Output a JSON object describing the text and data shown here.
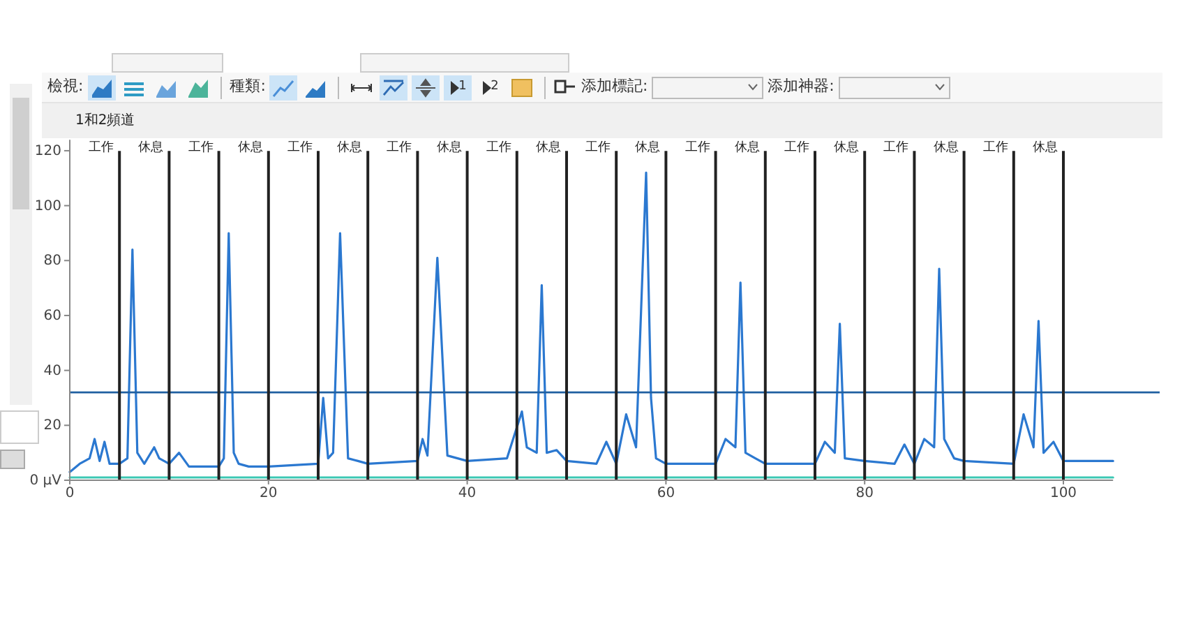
{
  "toolbar": {
    "view_label": "檢視:",
    "view_buttons": [
      {
        "selected": true
      },
      {
        "selected": false
      },
      {
        "selected": false
      },
      {
        "selected": false
      }
    ],
    "type_label": "種類:",
    "type_buttons": [
      {
        "selected": true
      },
      {
        "selected": false
      }
    ],
    "tool_buttons": [
      {
        "kind": "fit",
        "selected": false
      },
      {
        "kind": "zoom",
        "selected": true
      },
      {
        "kind": "pan",
        "selected": true
      },
      {
        "kind": "cursor1",
        "label": "1",
        "selected": true
      },
      {
        "kind": "cursor2",
        "label": "2",
        "selected": false
      },
      {
        "kind": "color",
        "selected": false
      }
    ],
    "marker_label": "添加標記:",
    "artifact_label": "添加神器:"
  },
  "chart_title": "1和2頻道",
  "chart_data": {
    "type": "line",
    "xlim": [
      0,
      105
    ],
    "ylim": [
      0,
      124
    ],
    "xticks": [
      0,
      20,
      40,
      60,
      80,
      100
    ],
    "yticks": [
      {
        "value": 0,
        "label": "0 µV"
      },
      20,
      40,
      60,
      80,
      100,
      120
    ],
    "x": [
      0,
      1,
      2,
      2.5,
      3,
      3.5,
      4,
      5,
      5.8,
      6.3,
      6.8,
      7.5,
      8.5,
      9,
      10,
      11,
      12,
      15,
      15.5,
      16,
      16.5,
      17,
      18,
      20,
      25,
      25.5,
      26,
      26.5,
      27.2,
      28,
      29,
      30,
      35,
      35.5,
      36,
      37,
      38,
      40,
      44,
      45.5,
      46,
      47,
      47.5,
      48,
      49,
      50,
      53,
      54,
      55,
      56,
      57,
      58,
      58.5,
      59,
      60,
      65,
      66,
      67,
      67.5,
      68,
      69,
      70,
      75,
      76,
      77,
      77.5,
      78,
      80,
      83,
      84,
      85,
      86,
      87,
      87.5,
      88,
      89,
      90,
      95,
      96,
      97,
      97.5,
      98,
      99,
      100,
      105
    ],
    "series": [
      {
        "color": "#2b78d0",
        "values": [
          3,
          6,
          8,
          15,
          7,
          14,
          6,
          6,
          8,
          84,
          10,
          6,
          12,
          8,
          6,
          10,
          5,
          5,
          8,
          90,
          10,
          6,
          5,
          5,
          6,
          30,
          8,
          10,
          90,
          8,
          7,
          6,
          7,
          15,
          9,
          81,
          9,
          7,
          8,
          25,
          12,
          10,
          71,
          10,
          11,
          7,
          6,
          14,
          6,
          24,
          12,
          112,
          30,
          8,
          6,
          6,
          15,
          12,
          72,
          10,
          8,
          6,
          6,
          14,
          10,
          57,
          8,
          7,
          6,
          13,
          6,
          15,
          12,
          77,
          15,
          8,
          7,
          6,
          24,
          12,
          58,
          10,
          14,
          7,
          7
        ]
      },
      {
        "color": "#3cc8b4",
        "values": [
          1,
          1,
          1,
          1,
          1,
          1,
          1,
          1,
          1,
          1,
          1,
          1,
          1,
          1,
          1,
          1,
          1,
          1,
          1,
          1,
          1,
          1,
          1,
          1,
          1,
          1,
          1,
          1,
          1,
          1,
          1,
          1,
          1,
          1,
          1,
          1,
          1,
          1,
          1,
          1,
          1,
          1,
          1,
          1,
          1,
          1,
          1,
          1,
          1,
          1,
          1,
          1,
          1,
          1,
          1,
          1,
          1,
          1,
          1,
          1,
          1,
          1,
          1,
          1,
          1,
          1,
          1,
          1,
          1,
          1,
          1,
          1,
          1,
          1,
          1,
          1,
          1,
          1,
          1,
          1,
          1,
          1,
          1,
          1,
          1
        ]
      }
    ],
    "ref_lines": [
      {
        "axis": "y",
        "value": 32
      },
      {
        "axis": "x",
        "value": 5,
        "label": "工作"
      },
      {
        "axis": "x",
        "value": 10,
        "label": "休息"
      },
      {
        "axis": "x",
        "value": 15,
        "label": "工作"
      },
      {
        "axis": "x",
        "value": 20,
        "label": "休息"
      },
      {
        "axis": "x",
        "value": 25,
        "label": "工作"
      },
      {
        "axis": "x",
        "value": 30,
        "label": "休息"
      },
      {
        "axis": "x",
        "value": 35,
        "label": "工作"
      },
      {
        "axis": "x",
        "value": 40,
        "label": "休息"
      },
      {
        "axis": "x",
        "value": 45,
        "label": "工作"
      },
      {
        "axis": "x",
        "value": 50,
        "label": "休息"
      },
      {
        "axis": "x",
        "value": 55,
        "label": "工作"
      },
      {
        "axis": "x",
        "value": 60,
        "label": "休息"
      },
      {
        "axis": "x",
        "value": 65,
        "label": "工作"
      },
      {
        "axis": "x",
        "value": 70,
        "label": "休息"
      },
      {
        "axis": "x",
        "value": 75,
        "label": "工作"
      },
      {
        "axis": "x",
        "value": 80,
        "label": "休息"
      },
      {
        "axis": "x",
        "value": 85,
        "label": "工作"
      },
      {
        "axis": "x",
        "value": 90,
        "label": "休息"
      },
      {
        "axis": "x",
        "value": 95,
        "label": "工作"
      },
      {
        "axis": "x",
        "value": 100,
        "label": "休息"
      }
    ]
  }
}
